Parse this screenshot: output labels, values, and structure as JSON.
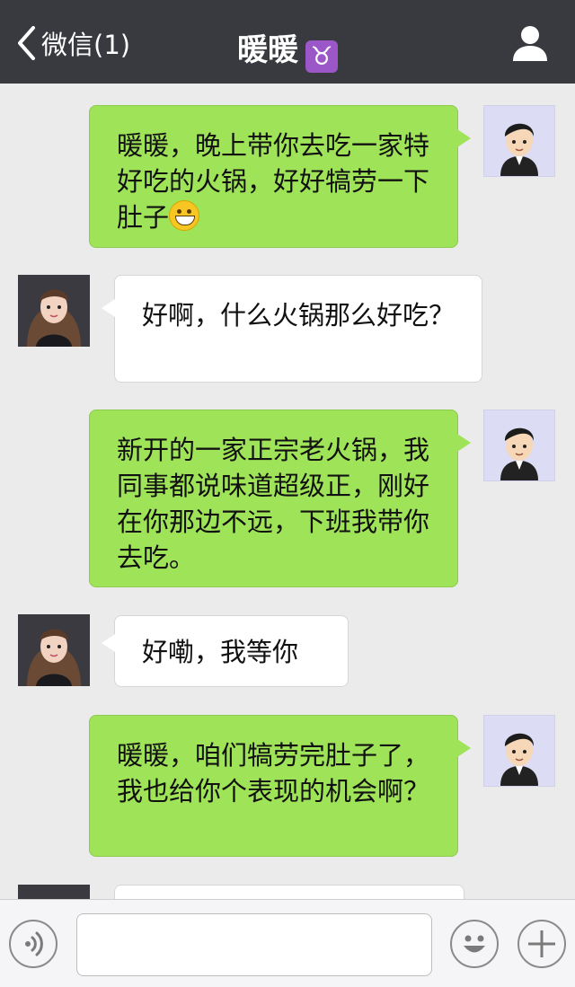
{
  "header": {
    "back_label": "微信(1)",
    "title": "暖暖",
    "title_badge": "♉"
  },
  "messages": [
    {
      "from": "me",
      "text": "暖暖，晚上带你去吃一家特好吃的火锅，好好犒劳一下肚子",
      "emoji": "grin-emoji"
    },
    {
      "from": "her",
      "text": "好啊，什么火锅那么好吃？"
    },
    {
      "from": "me",
      "text": "新开的一家正宗老火锅，我同事都说味道超级正，刚好在你那边不远，下班我带你去吃。"
    },
    {
      "from": "her",
      "text": "好嘞，我等你"
    },
    {
      "from": "me",
      "text": "暖暖，咱们犒劳完肚子了，我也给你个表现的机会啊？"
    }
  ],
  "footer": {
    "input_value": "",
    "icons": [
      "voice-icon",
      "emoji-icon",
      "plus-icon"
    ]
  },
  "colors": {
    "header_bg": "#393a3f",
    "chat_bg": "#ebebeb",
    "sent_bubble": "#9fe358",
    "recv_bubble": "#ffffff"
  }
}
